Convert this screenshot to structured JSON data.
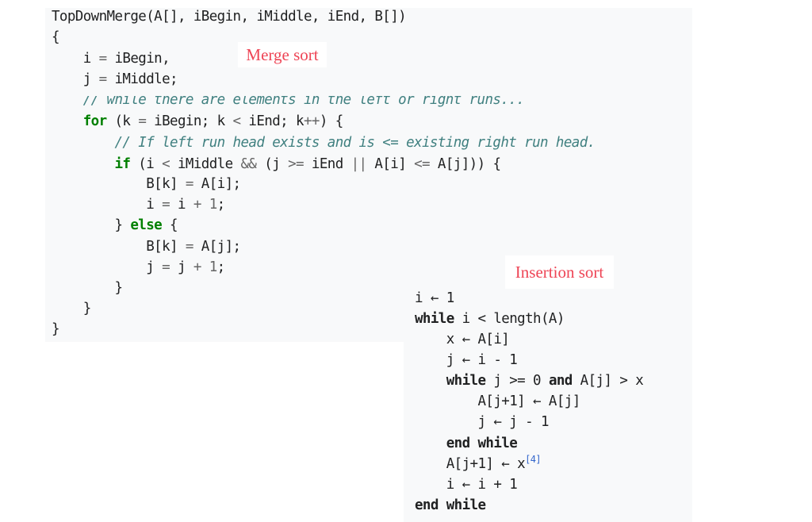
{
  "merge_sort": {
    "label": "Merge sort",
    "lines": [
      [
        {
          "t": "TopDownMerge(A[], iBegin, iMiddle, iEnd, B[])",
          "c": ""
        }
      ],
      [
        {
          "t": "{",
          "c": ""
        }
      ],
      [
        {
          "t": "    i ",
          "c": ""
        },
        {
          "t": "=",
          "c": "op"
        },
        {
          "t": " iBegin,",
          "c": ""
        }
      ],
      [
        {
          "t": "    j ",
          "c": ""
        },
        {
          "t": "=",
          "c": "op"
        },
        {
          "t": " iMiddle;",
          "c": ""
        }
      ],
      [
        {
          "t": "    // while there are elements in the left or right runs...",
          "c": "cm"
        }
      ],
      [
        {
          "t": "    ",
          "c": ""
        },
        {
          "t": "for",
          "c": "kw"
        },
        {
          "t": " (k ",
          "c": ""
        },
        {
          "t": "=",
          "c": "op"
        },
        {
          "t": " iBegin; k ",
          "c": ""
        },
        {
          "t": "<",
          "c": "op"
        },
        {
          "t": " iEnd; k",
          "c": ""
        },
        {
          "t": "++",
          "c": "op"
        },
        {
          "t": ") {",
          "c": ""
        }
      ],
      [
        {
          "t": "        // If left run head exists and is <= existing right run head.",
          "c": "cm"
        }
      ],
      [
        {
          "t": "        ",
          "c": ""
        },
        {
          "t": "if",
          "c": "kw"
        },
        {
          "t": " (i ",
          "c": ""
        },
        {
          "t": "<",
          "c": "op"
        },
        {
          "t": " iMiddle ",
          "c": ""
        },
        {
          "t": "&&",
          "c": "op"
        },
        {
          "t": " (j ",
          "c": ""
        },
        {
          "t": ">=",
          "c": "op"
        },
        {
          "t": " iEnd ",
          "c": ""
        },
        {
          "t": "||",
          "c": "op"
        },
        {
          "t": " A[i] ",
          "c": ""
        },
        {
          "t": "<=",
          "c": "op"
        },
        {
          "t": " A[j])) {",
          "c": ""
        }
      ],
      [
        {
          "t": "            B[k] ",
          "c": ""
        },
        {
          "t": "=",
          "c": "op"
        },
        {
          "t": " A[i];",
          "c": ""
        }
      ],
      [
        {
          "t": "            i ",
          "c": ""
        },
        {
          "t": "=",
          "c": "op"
        },
        {
          "t": " i ",
          "c": ""
        },
        {
          "t": "+",
          "c": "op"
        },
        {
          "t": " ",
          "c": ""
        },
        {
          "t": "1",
          "c": "num"
        },
        {
          "t": ";",
          "c": ""
        }
      ],
      [
        {
          "t": "        } ",
          "c": ""
        },
        {
          "t": "else",
          "c": "kw"
        },
        {
          "t": " {",
          "c": ""
        }
      ],
      [
        {
          "t": "            B[k] ",
          "c": ""
        },
        {
          "t": "=",
          "c": "op"
        },
        {
          "t": " A[j];",
          "c": ""
        }
      ],
      [
        {
          "t": "            j ",
          "c": ""
        },
        {
          "t": "=",
          "c": "op"
        },
        {
          "t": " j ",
          "c": ""
        },
        {
          "t": "+",
          "c": "op"
        },
        {
          "t": " ",
          "c": ""
        },
        {
          "t": "1",
          "c": "num"
        },
        {
          "t": ";",
          "c": ""
        }
      ],
      [
        {
          "t": "        }",
          "c": ""
        }
      ],
      [
        {
          "t": "    }",
          "c": ""
        }
      ],
      [
        {
          "t": "}",
          "c": ""
        }
      ]
    ]
  },
  "insertion_sort": {
    "label": "Insertion sort",
    "lines": [
      [
        {
          "t": "i ← 1",
          "c": ""
        }
      ],
      [
        {
          "t": "while",
          "c": "kw-bold"
        },
        {
          "t": " i < length(A)",
          "c": ""
        }
      ],
      [
        {
          "t": "    x ← A[i]",
          "c": ""
        }
      ],
      [
        {
          "t": "    j ← i - 1",
          "c": ""
        }
      ],
      [
        {
          "t": "    ",
          "c": ""
        },
        {
          "t": "while",
          "c": "kw-bold"
        },
        {
          "t": " j >= 0 ",
          "c": ""
        },
        {
          "t": "and",
          "c": "kw-bold"
        },
        {
          "t": " A[j] > x",
          "c": ""
        }
      ],
      [
        {
          "t": "        A[j+1] ← A[j]",
          "c": ""
        }
      ],
      [
        {
          "t": "        j ← j - 1",
          "c": ""
        }
      ],
      [
        {
          "t": "    ",
          "c": ""
        },
        {
          "t": "end while",
          "c": "kw-bold"
        }
      ],
      [
        {
          "t": "    A[j+1] ← x",
          "c": ""
        },
        {
          "t": "[4]",
          "c": "ref"
        }
      ],
      [
        {
          "t": "    i ← i + 1",
          "c": ""
        }
      ],
      [
        {
          "t": "end while",
          "c": "kw-bold"
        }
      ]
    ]
  }
}
